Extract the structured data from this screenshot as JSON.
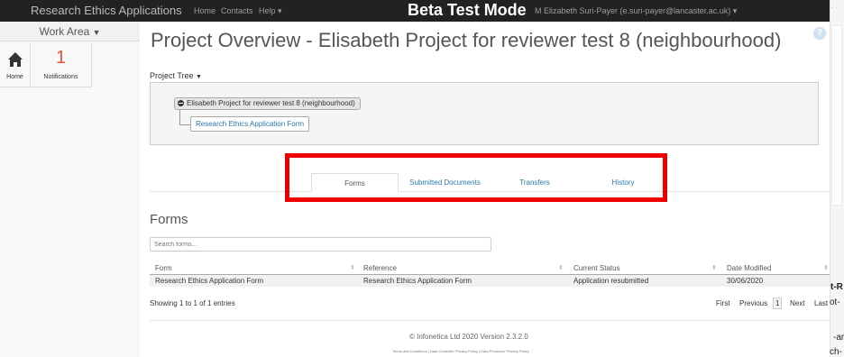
{
  "navbar": {
    "brand": "Research Ethics Applications",
    "links": [
      "Home",
      "Contacts",
      "Help"
    ],
    "beta_label": "Beta Test Mode",
    "user": "M Elizabeth Suri-Payer (e.suri-payer@lancaster.ac.uk)"
  },
  "sidebar": {
    "work_area": "Work Area",
    "home_label": "Home",
    "notifications_count": "1",
    "notifications_label": "Notifications"
  },
  "page": {
    "title": "Project Overview - Elisabeth Project for reviewer test 8 (neighbourhood)",
    "help": "?"
  },
  "project_tree": {
    "label": "Project Tree",
    "root": "Elisabeth Project for reviewer test 8 (neighbourhood)",
    "child": "Research Ethics Application Form"
  },
  "tabs": [
    {
      "label": "Forms",
      "active": true
    },
    {
      "label": "Submitted Documents",
      "active": false
    },
    {
      "label": "Transfers",
      "active": false
    },
    {
      "label": "History",
      "active": false
    }
  ],
  "forms": {
    "heading": "Forms",
    "search_placeholder": "Search forms...",
    "columns": [
      "Form",
      "Reference",
      "Current Status",
      "Date Modified"
    ],
    "rows": [
      {
        "form": "Research Ethics Application Form",
        "reference": "Research Ethics Application Form",
        "status": "Application resubmitted",
        "date": "30/06/2020"
      }
    ],
    "showing": "Showing 1 to 1 of 1 entries",
    "pager": [
      "First",
      "Previous",
      "1",
      "Next",
      "Last"
    ]
  },
  "footer": {
    "copyright": "© Infonetica Ltd 2020 Version 2.3.2.0",
    "links": "Terms and Conditions | Data Controller Privacy Policy | Data Processor Privacy Policy"
  },
  "right_edge_fragments": [
    "t-R",
    "ot-",
    "-ar",
    "ch-"
  ],
  "colors": {
    "highlight": "#ee0000",
    "link": "#2a7ab0",
    "navbar": "#222222"
  }
}
